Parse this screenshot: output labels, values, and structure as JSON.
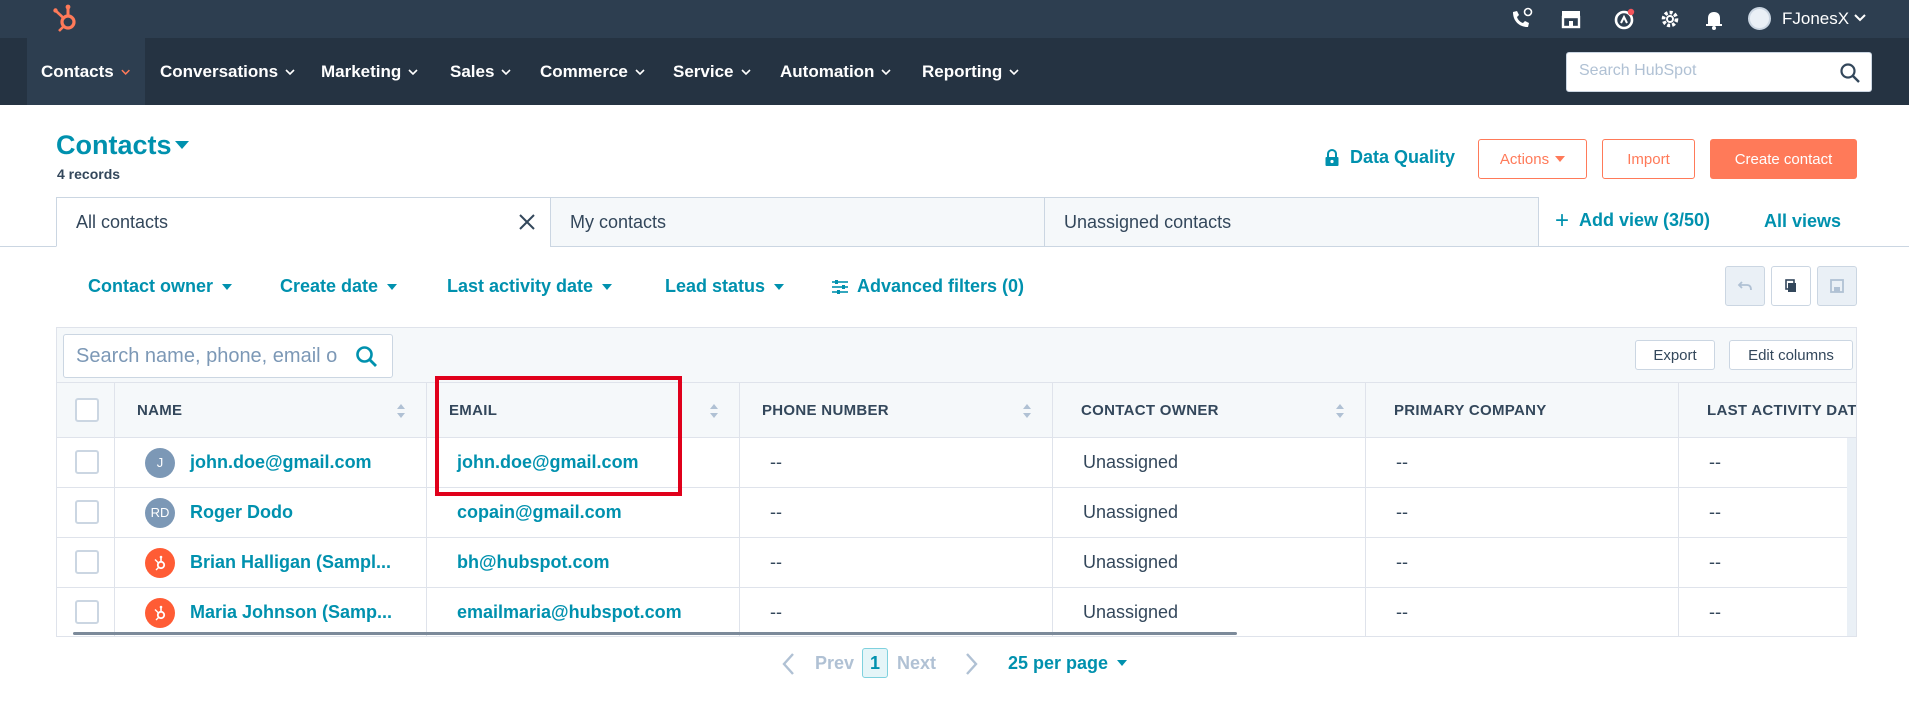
{
  "topbar": {
    "user_name": "FJonesX",
    "icons": [
      "calling-icon",
      "marketplace-icon",
      "help-icon",
      "settings-icon",
      "notifications-icon"
    ]
  },
  "nav": {
    "items": [
      {
        "label": "Contacts",
        "active": true
      },
      {
        "label": "Conversations"
      },
      {
        "label": "Marketing"
      },
      {
        "label": "Sales"
      },
      {
        "label": "Commerce"
      },
      {
        "label": "Service"
      },
      {
        "label": "Automation"
      },
      {
        "label": "Reporting"
      }
    ],
    "search_placeholder": "Search HubSpot"
  },
  "header": {
    "title": "Contacts",
    "record_count": "4 records",
    "data_quality": "Data Quality",
    "actions": "Actions",
    "import": "Import",
    "create_contact": "Create contact"
  },
  "views": {
    "tabs": [
      {
        "label": "All contacts",
        "active": true
      },
      {
        "label": "My contacts"
      },
      {
        "label": "Unassigned contacts"
      }
    ],
    "add_view": "Add view (3/50)",
    "all_views": "All views"
  },
  "filters": {
    "contact_owner": "Contact owner",
    "create_date": "Create date",
    "last_activity_date": "Last activity date",
    "lead_status": "Lead status",
    "advanced": "Advanced filters (0)"
  },
  "table": {
    "search_placeholder": "Search name, phone, email o",
    "export": "Export",
    "edit_columns": "Edit columns",
    "columns": [
      "NAME",
      "EMAIL",
      "PHONE NUMBER",
      "CONTACT OWNER",
      "PRIMARY COMPANY",
      "LAST ACTIVITY DATE"
    ],
    "rows": [
      {
        "avatar": "J",
        "avatar_type": "initials",
        "name": "john.doe@gmail.com",
        "email": "john.doe@gmail.com",
        "phone": "--",
        "owner": "Unassigned",
        "company": "--",
        "last_activity": "--"
      },
      {
        "avatar": "RD",
        "avatar_type": "initials",
        "name": "Roger Dodo",
        "email": "copain@gmail.com",
        "phone": "--",
        "owner": "Unassigned",
        "company": "--",
        "last_activity": "--"
      },
      {
        "avatar": "",
        "avatar_type": "hubspot",
        "name": "Brian Halligan (Sampl...",
        "email": "bh@hubspot.com",
        "phone": "--",
        "owner": "Unassigned",
        "company": "--",
        "last_activity": "--"
      },
      {
        "avatar": "",
        "avatar_type": "hubspot",
        "name": "Maria Johnson (Samp...",
        "email": "emailmaria@hubspot.com",
        "phone": "--",
        "owner": "Unassigned",
        "company": "--",
        "last_activity": "--"
      }
    ]
  },
  "pagination": {
    "prev": "Prev",
    "current_page": "1",
    "next": "Next",
    "per_page": "25 per page"
  },
  "colors": {
    "accent": "#0091ae",
    "brand_orange": "#ff7a59",
    "nav_bg": "#253342",
    "highlight": "#e0001b"
  }
}
